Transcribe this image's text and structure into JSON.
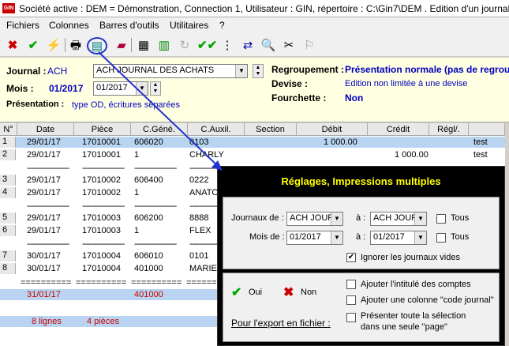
{
  "titlebar": {
    "logo": "GIN",
    "title": "Société active : DEM = Démonstration, Connection 1, Utilisateur : GIN, répertoire : C:\\Gin7\\DEM . Edition d'un journal"
  },
  "menu": [
    "Fichiers",
    "Colonnes",
    "Barres d'outils",
    "Utilitaires",
    "?"
  ],
  "header": {
    "journal_label": "Journal :",
    "journal_code": "ACH",
    "journal_combo": "ACH JOURNAL DES ACHATS",
    "mois_label": "Mois :",
    "mois_value": "01/2017",
    "mois_combo": "01/2017",
    "presentation_label": "Présentation :",
    "presentation_value": "type OD, écritures séparées",
    "regroupement_label": "Regroupement :",
    "regroupement_value": "Présentation normale (pas de regrou",
    "devise_label": "Devise :",
    "devise_value": "Edition non limitée à une devise",
    "fourchette_label": "Fourchette :",
    "fourchette_value": "Non"
  },
  "grid": {
    "columns": [
      "N°",
      "Date",
      "Pièce",
      "C.Géné.",
      "C.Auxil.",
      "Section",
      "Débit",
      "Crédit",
      "Régl/."
    ],
    "rows": [
      {
        "n": "1",
        "date": "29/01/17",
        "piece": "17010001",
        "gen": "606020",
        "aux": "0103",
        "debit": "1 000.00",
        "credit": "",
        "extra": "test",
        "selected": true
      },
      {
        "n": "2",
        "date": "29/01/17",
        "piece": "17010001",
        "gen": "1",
        "aux": "CHARLY",
        "debit": "",
        "credit": "1 000.00",
        "extra": "test"
      },
      {
        "n": "3",
        "date": "29/01/17",
        "piece": "17010002",
        "gen": "606400",
        "aux": "0222",
        "debit": "",
        "credit": "",
        "extra": ""
      },
      {
        "n": "4",
        "date": "29/01/17",
        "piece": "17010002",
        "gen": "1",
        "aux": "ANATO",
        "debit": "",
        "credit": "",
        "extra": ""
      },
      {
        "n": "5",
        "date": "29/01/17",
        "piece": "17010003",
        "gen": "606200",
        "aux": "8888",
        "debit": "",
        "credit": "",
        "extra": ""
      },
      {
        "n": "6",
        "date": "29/01/17",
        "piece": "17010003",
        "gen": "1",
        "aux": "FLEX",
        "debit": "",
        "credit": "",
        "extra": ""
      },
      {
        "n": "7",
        "date": "30/01/17",
        "piece": "17010004",
        "gen": "606010",
        "aux": "0101",
        "debit": "",
        "credit": "",
        "extra": ""
      },
      {
        "n": "8",
        "date": "30/01/17",
        "piece": "17010004",
        "gen": "401000",
        "aux": "MARIE",
        "debit": "",
        "credit": "",
        "extra": ""
      }
    ],
    "separator": "==========",
    "dashes": "--------------------",
    "total_date": "31/01/17",
    "total_gen": "401000",
    "summary_lines": "8 lignes",
    "summary_pieces": "4 pièces"
  },
  "dialog": {
    "title": "Réglages, Impressions multiples",
    "journaux_label": "Journaux de :",
    "journaux_from": "ACH JOUF",
    "journaux_to": "ACH JOUF",
    "a_label": "à :",
    "tous_label": "Tous",
    "mois_label": "Mois de :",
    "mois_from": "01/2017",
    "mois_to": "01/2017",
    "ignore_label": "Ignorer les journaux vides",
    "ok_label": "Oui",
    "cancel_label": "Non",
    "opt1": "Ajouter l'intitulé des comptes",
    "opt2": "Ajouter une colonne \"code journal\"",
    "opt3a": "Présenter toute la sélection",
    "opt3b": "dans une seule \"page\"",
    "export_label": "Pour l'export en fichier :"
  },
  "colors": {
    "accent": "#0000c0",
    "selection": "#b8d4f0",
    "dialog_title": "#ffff00"
  }
}
